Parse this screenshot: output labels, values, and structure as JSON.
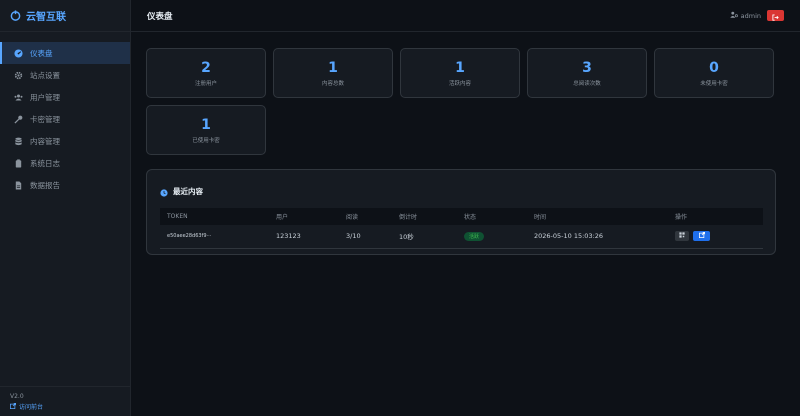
{
  "brand": {
    "name": "云智互联"
  },
  "sidebar": {
    "items": [
      {
        "label": "仪表盘",
        "icon": "dashboard-icon",
        "active": true
      },
      {
        "label": "站点设置",
        "icon": "gear-icon"
      },
      {
        "label": "用户管理",
        "icon": "users-icon"
      },
      {
        "label": "卡密管理",
        "icon": "key-icon"
      },
      {
        "label": "内容管理",
        "icon": "database-icon"
      },
      {
        "label": "系统日志",
        "icon": "clipboard-icon"
      },
      {
        "label": "数据报告",
        "icon": "file-icon"
      }
    ],
    "footer": {
      "version": "V2.0",
      "link_label": "访问前台"
    }
  },
  "header": {
    "title": "仪表盘",
    "username": "admin"
  },
  "stats": [
    {
      "value": "2",
      "label": "注册用户"
    },
    {
      "value": "1",
      "label": "内容总数"
    },
    {
      "value": "1",
      "label": "活跃内容"
    },
    {
      "value": "3",
      "label": "总阅读次数"
    },
    {
      "value": "0",
      "label": "未使用卡密"
    },
    {
      "value": "1",
      "label": "已使用卡密"
    }
  ],
  "recent": {
    "title": "最近内容",
    "columns": [
      "TOKEN",
      "用户",
      "阅读",
      "倒计时",
      "状态",
      "时间",
      "操作"
    ],
    "rows": [
      {
        "token": "e50aee28d63f9···",
        "user": "123123",
        "reads": "3/10",
        "countdown": "10秒",
        "status": "活跃",
        "time": "2026-05-10 15:03:26"
      }
    ]
  },
  "colors": {
    "accent": "#58a6ff",
    "background": "#0d1117",
    "panel": "#161b22",
    "danger": "#da3633",
    "success": "#3fb950"
  }
}
